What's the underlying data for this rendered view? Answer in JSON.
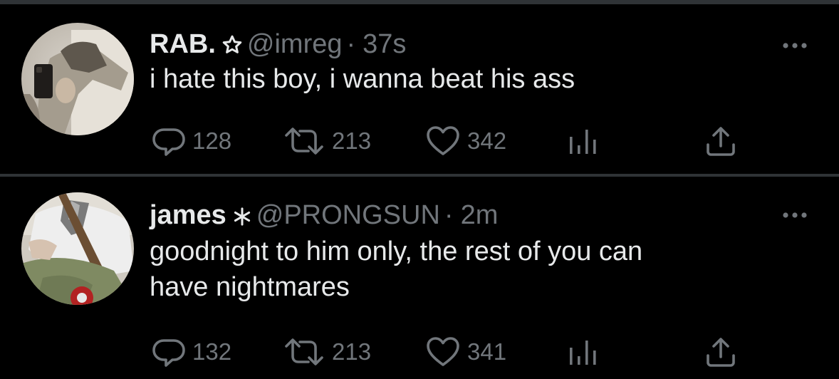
{
  "colors": {
    "background": "#000000",
    "divider": "#2f3336",
    "primary_text": "#e7e9ea",
    "secondary_text": "#71767b"
  },
  "tweets": [
    {
      "display_name": "RAB.",
      "badge_icon": "star-outline-icon",
      "handle": "@imreg",
      "separator": "·",
      "time": "37s",
      "text": "i hate this boy, i wanna beat his ass",
      "replies": "128",
      "retweets": "213",
      "likes": "342"
    },
    {
      "display_name": "james",
      "badge_icon": "asterisk-icon",
      "handle": "@PRONGSUN",
      "separator": "·",
      "time": "2m",
      "text_lines": [
        "goodnight to him only, the rest of you can",
        "have nightmares"
      ],
      "replies": "132",
      "retweets": "213",
      "likes": "341"
    }
  ]
}
